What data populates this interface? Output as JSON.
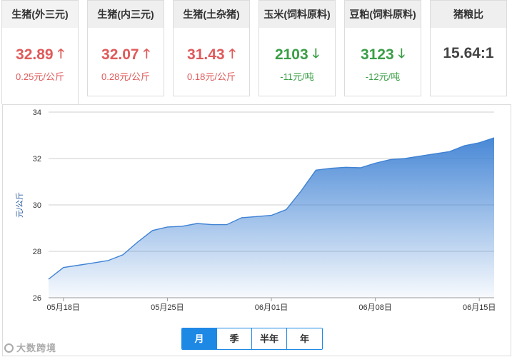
{
  "cards": [
    {
      "title": "生猪(外三元)",
      "value": "32.89",
      "change": "0.25元/公斤",
      "trend": "up",
      "arrow": "🡑"
    },
    {
      "title": "生猪(内三元)",
      "value": "32.07",
      "change": "0.28元/公斤",
      "trend": "up",
      "arrow": "🡑"
    },
    {
      "title": "生猪(土杂猪)",
      "value": "31.43",
      "change": "0.18元/公斤",
      "trend": "up",
      "arrow": "🡑"
    },
    {
      "title": "玉米(饲料原料)",
      "value": "2103",
      "change": "-11元/吨",
      "trend": "down",
      "arrow": "🡓"
    },
    {
      "title": "豆粕(饲料原料)",
      "value": "3123",
      "change": "-12元/吨",
      "trend": "down",
      "arrow": "🡓"
    },
    {
      "title": "猪粮比",
      "value": "15.64:1",
      "change": "",
      "trend": "neutral",
      "arrow": ""
    }
  ],
  "colors": {
    "up": "#e05a5a",
    "down": "#3a9e46",
    "accent": "#1e88e5",
    "line": "#3f82d4"
  },
  "chart_data": {
    "type": "area",
    "title": "",
    "ylabel": "元/公斤",
    "xlabel": "",
    "ylim": [
      26,
      34
    ],
    "yticks": [
      26,
      28,
      30,
      32,
      34
    ],
    "xticks": [
      "05月18日",
      "05月25日",
      "06月01日",
      "06月08日",
      "06月15日"
    ],
    "grid": true,
    "x": [
      "05-17",
      "05-18",
      "05-19",
      "05-20",
      "05-21",
      "05-22",
      "05-23",
      "05-24",
      "05-25",
      "05-26",
      "05-27",
      "05-28",
      "05-29",
      "05-30",
      "05-31",
      "06-01",
      "06-02",
      "06-03",
      "06-04",
      "06-05",
      "06-06",
      "06-07",
      "06-08",
      "06-09",
      "06-10",
      "06-11",
      "06-12",
      "06-13",
      "06-14",
      "06-15",
      "06-16"
    ],
    "values": [
      26.8,
      27.3,
      27.4,
      27.5,
      27.6,
      27.85,
      28.4,
      28.9,
      29.05,
      29.08,
      29.2,
      29.15,
      29.15,
      29.45,
      29.5,
      29.55,
      29.8,
      30.6,
      31.5,
      31.58,
      31.62,
      31.6,
      31.8,
      31.95,
      32.0,
      32.1,
      32.2,
      32.3,
      32.55,
      32.68,
      32.89
    ]
  },
  "range_buttons": [
    {
      "label": "月",
      "selected": true
    },
    {
      "label": "季",
      "selected": false
    },
    {
      "label": "半年",
      "selected": false
    },
    {
      "label": "年",
      "selected": false
    }
  ],
  "watermark": "大数跨境"
}
